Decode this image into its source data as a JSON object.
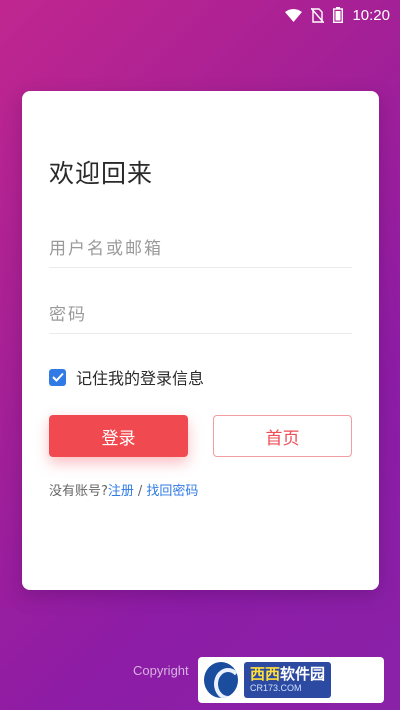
{
  "status_bar": {
    "time": "10:20",
    "icons": [
      "wifi-icon",
      "no-sim-icon",
      "battery-icon"
    ]
  },
  "login": {
    "title": "欢迎回来",
    "username_placeholder": "用户名或邮箱",
    "password_placeholder": "密码",
    "remember_label": "记住我的登录信息",
    "remember_checked": true,
    "login_button": "登录",
    "home_button": "首页",
    "no_account_text": "没有账号?",
    "register_link": "注册",
    "separator": "/",
    "forgot_link": "找回密码"
  },
  "footer": {
    "copyright": "Copyright"
  },
  "watermark": {
    "brand_part1": "西西",
    "brand_part2": "软件园",
    "domain": "CR173.COM"
  },
  "colors": {
    "primary_red": "#f0494f",
    "link_blue": "#2f7ae5",
    "background_gradient": [
      "#c0268f",
      "#8a22a8"
    ]
  }
}
